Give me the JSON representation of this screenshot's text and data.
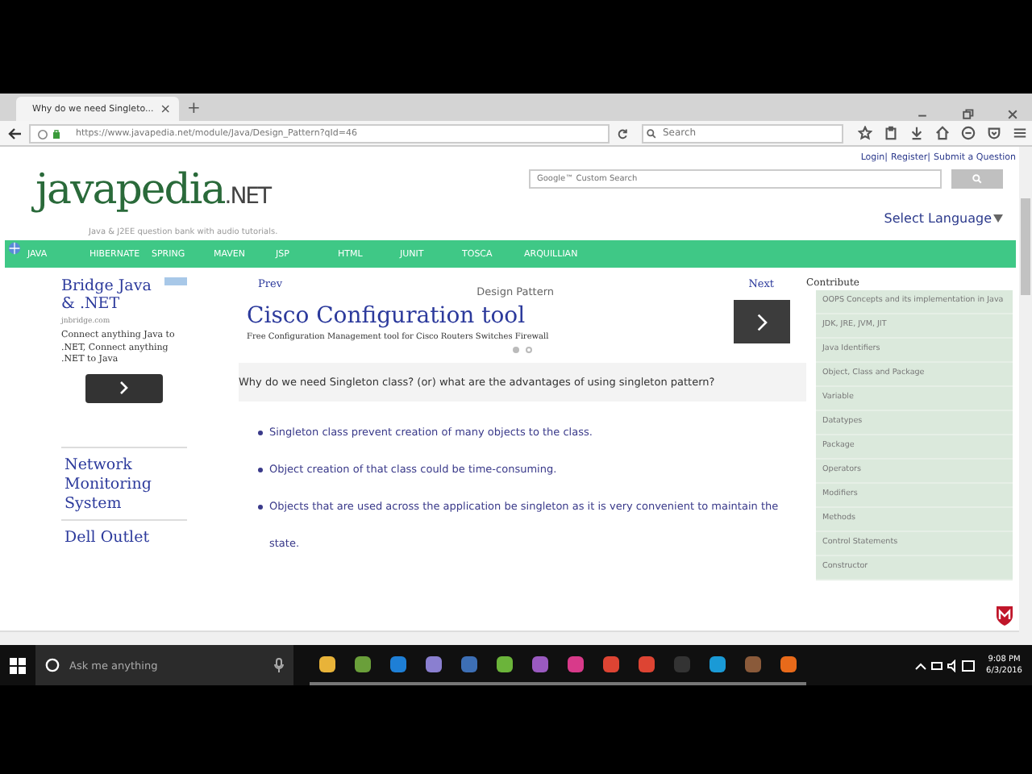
{
  "browser": {
    "tab_title": "Why do we need Singleto...",
    "tab_close": "×",
    "new_tab": "+",
    "url": "https://www.javapedia.net/module/Java/Design_Pattern?qId=46",
    "search_placeholder": "Search"
  },
  "header": {
    "top_links": [
      "Login|",
      "Register|",
      "Submit a Question"
    ],
    "logo_main": "javapedia",
    "logo_suffix": ".NET",
    "search_placeholder": "Google™ Custom Search",
    "language": "Select Language",
    "tagline": "Java & J2EE question bank with audio tutorials."
  },
  "nav": [
    "JAVA",
    "HIBERNATE",
    "SPRING",
    "MAVEN",
    "JSP",
    "HTML",
    "JUNIT",
    "TOSCA",
    "ARQUILLIAN"
  ],
  "left_ad": {
    "title": "Bridge Java & .NET",
    "domain": "jnbridge.com",
    "text": "Connect anything Java to .NET, Connect anything .NET to Java",
    "links": [
      "Network Monitoring System",
      "Dell Outlet"
    ]
  },
  "article": {
    "prev": "Prev",
    "title": "Design Pattern",
    "next": "Next",
    "ad_title": "Cisco Configuration tool",
    "ad_text": "Free Configuration Management tool for Cisco Routers Switches Firewall",
    "dots": [
      {
        "selected": true
      },
      {
        "selected": false
      }
    ],
    "question": "Why do we need Singleton class? (or) what are the advantages of using singleton pattern?",
    "bullets": [
      "Singleton class prevent creation of many objects to the class.",
      "Object creation of that class could be time-consuming.",
      "Objects that are used across the application be singleton as it is very convenient to maintain the state."
    ]
  },
  "sidebar": {
    "title": "Contribute",
    "items": [
      "OOPS Concepts and its implementation in Java",
      "JDK, JRE, JVM, JIT",
      "Java Identifiers",
      "Object, Class and Package",
      "Variable",
      "Datatypes",
      "Package",
      "Operators",
      "Modifiers",
      "Methods",
      "Control Statements",
      "Constructor"
    ]
  },
  "taskbar": {
    "search_placeholder": "Ask me anything",
    "time": "9:08 PM",
    "date": "6/3/2016",
    "apps": [
      {
        "color": "#e8b339"
      },
      {
        "color": "#6a9f3a"
      },
      {
        "color": "#1e7fd6"
      },
      {
        "color": "#8a7fd0"
      },
      {
        "color": "#3d6fb5"
      },
      {
        "color": "#6bb43a"
      },
      {
        "color": "#9a5ac0"
      },
      {
        "color": "#d83a8a"
      },
      {
        "color": "#dd4433"
      },
      {
        "color": "#dd4433"
      },
      {
        "color": "#333333"
      },
      {
        "color": "#1a9ad6"
      },
      {
        "color": "#8a5a3a"
      },
      {
        "color": "#e86a1a"
      }
    ]
  }
}
